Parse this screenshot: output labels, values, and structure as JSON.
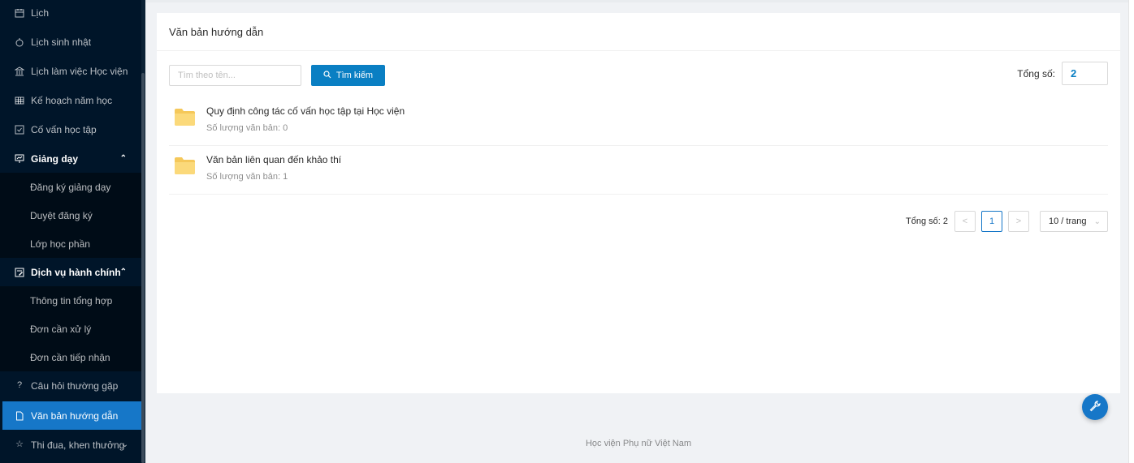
{
  "sidebar": {
    "items": [
      {
        "label": "Lịch",
        "icon": "calendar-icon"
      },
      {
        "label": "Lịch sinh nhật",
        "icon": "cake-icon"
      },
      {
        "label": "Lịch làm việc Học viện",
        "icon": "bank-icon"
      },
      {
        "label": "Kế hoạch năm học",
        "icon": "table-icon"
      },
      {
        "label": "Cố vấn học tập",
        "icon": "check-square-icon"
      },
      {
        "label": "Giảng dạy",
        "icon": "fund-projection-icon",
        "expanded": true
      },
      {
        "label": "Đăng ký giảng dạy"
      },
      {
        "label": "Duyệt đăng ký"
      },
      {
        "label": "Lớp học phần"
      },
      {
        "label": "Dịch vụ hành chính",
        "icon": "form-icon",
        "expanded": true
      },
      {
        "label": "Thông tin tổng hợp"
      },
      {
        "label": "Đơn cần xử lý"
      },
      {
        "label": "Đơn cần tiếp nhận"
      },
      {
        "label": "Câu hỏi thường gặp",
        "icon": "question-icon"
      },
      {
        "label": "Văn bản hướng dẫn",
        "icon": "file-icon",
        "active": true
      },
      {
        "label": "Thi đua, khen thưởng",
        "icon": "star-icon"
      }
    ]
  },
  "page": {
    "title": "Văn bản hướng dẫn",
    "search_placeholder": "Tìm theo tên...",
    "search_button": "Tìm kiếm",
    "total_label": "Tổng số:",
    "total_value": "2"
  },
  "folders": [
    {
      "name": "Quy định công tác cố vấn học tập tại Học viện",
      "count": "Số lượng văn bản: 0"
    },
    {
      "name": "Văn bản liên quan đến khảo thí",
      "count": "Số lượng văn bản: 1"
    }
  ],
  "pagination": {
    "total": "Tổng số: 2",
    "prev": "<",
    "current": "1",
    "next": ">",
    "page_size": "10 / trang"
  },
  "footer": "Học viện Phụ nữ Việt Nam",
  "colors": {
    "sidebar_bg": "#001529",
    "accent": "#1677c8",
    "button": "#0a7fc3",
    "folder": "#f7d070"
  }
}
